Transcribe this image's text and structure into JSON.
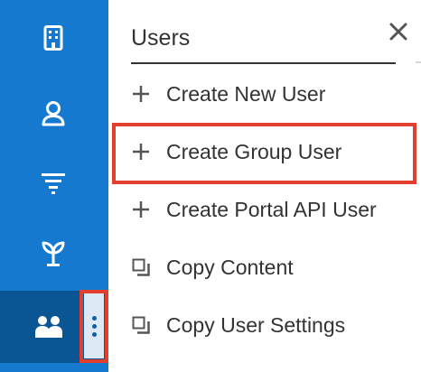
{
  "sidebar": {
    "items": [
      {
        "name": "building-icon"
      },
      {
        "name": "person-icon"
      },
      {
        "name": "filter-icon"
      },
      {
        "name": "sprout-icon"
      },
      {
        "name": "users-icon",
        "active": true
      }
    ],
    "more_icon": "kebab-vertical-icon"
  },
  "menu": {
    "title": "Users",
    "close_icon": "close-icon",
    "items": [
      {
        "label": "Create New User",
        "icon": "plus-icon"
      },
      {
        "label": "Create Group User",
        "icon": "plus-icon",
        "highlighted": true
      },
      {
        "label": "Create Portal API User",
        "icon": "plus-icon"
      },
      {
        "label": "Copy Content",
        "icon": "copy-icon"
      },
      {
        "label": "Copy User Settings",
        "icon": "copy-icon"
      }
    ]
  },
  "colors": {
    "sidebar": "#1479cf",
    "sidebar_active": "#0a5594",
    "highlight": "#e1402f",
    "text": "#333333"
  }
}
